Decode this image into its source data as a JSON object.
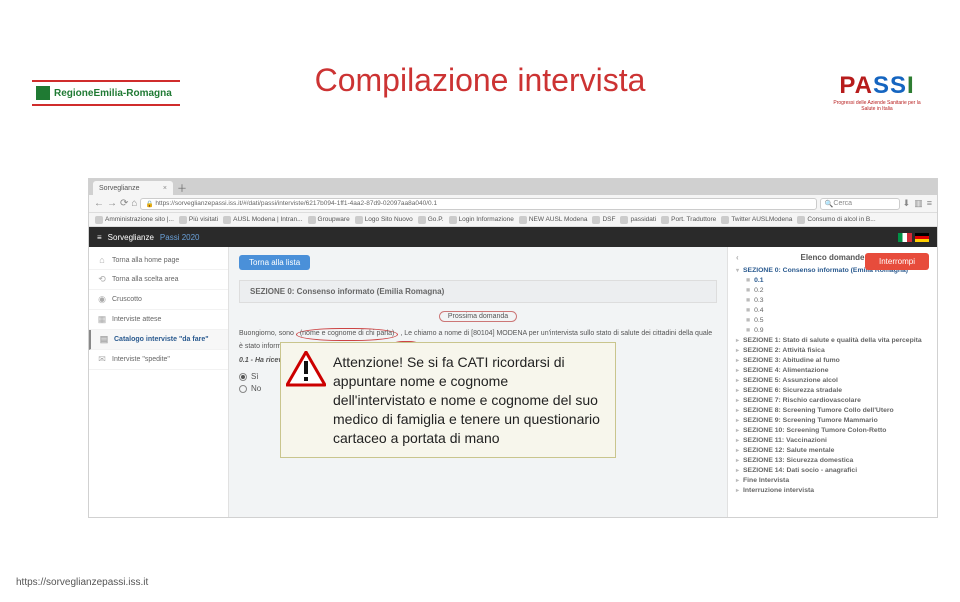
{
  "logo_left": "RegioneEmilia-Romagna",
  "logo_right": "PASSI",
  "logo_right_sub": "Progressi delle Aziende Sanitarie per la Salute in Italia",
  "title": "Compilazione intervista",
  "browser": {
    "tab": "Sorveglianze",
    "url": "https://sorveglianzepassi.iss.it/#/dati/passi/interviste/6217b094-1ff1-4aa2-87d9-02097aa8a040/0.1",
    "search": "Cerca",
    "bookmarks": [
      "Amministrazione sito |...",
      "Più visitati",
      "AUSL Modena | Intran...",
      "Groupware",
      "Logo Sito Nuovo",
      "Go.P.",
      "Login Informazione",
      "NEW AUSL Modena",
      "DSF",
      "passidati",
      "Port. Traduttore",
      "Twitter AUSLModena",
      "Consumo di alcol in B..."
    ]
  },
  "app_header": {
    "breadcrumb": "Sorveglianze",
    "project": "Passi 2020"
  },
  "sidebar": {
    "items": [
      "Torna alla home page",
      "Torna alla scelta area",
      "Cruscotto",
      "Interviste attese",
      "Catalogo interviste \"da fare\"",
      "Interviste \"spedite\""
    ],
    "active_index": 4
  },
  "interrupt_label": "Interrompi",
  "center": {
    "back_button": "Torna alla lista",
    "section_title": "SEZIONE 0: Consenso informato (Emilia Romagna)",
    "next_q": "Prossima domanda",
    "greeting_pre": "Buongiorno, sono ",
    "circle1": "(nome e cognome di chi parla)",
    "greeting_mid": ", Le chiamo a nome di [80104] MODENA per un'intervista sullo stato di salute dei cittadini della quale è stato informato anche il suo medico di famiglia ",
    "circle2": "(Dr. ...)",
    "q_num": "0.1 - Ha ricevuto per posta la lettera della ASL che Le preannuncia un'intervista telefonica?",
    "opt_yes": "Sì",
    "opt_no": "No"
  },
  "right": {
    "title": "Elenco domande",
    "sec0": "SEZIONE 0: Consenso informato (Emilia Romagna)",
    "subitems": [
      "0.1",
      "0.2",
      "0.3",
      "0.4",
      "0.5",
      "0.9"
    ],
    "sections": [
      "SEZIONE 1: Stato di salute e qualità della vita percepita",
      "SEZIONE 2: Attività fisica",
      "SEZIONE 3: Abitudine al fumo",
      "SEZIONE 4: Alimentazione",
      "SEZIONE 5: Assunzione alcol",
      "SEZIONE 6: Sicurezza stradale",
      "SEZIONE 7: Rischio cardiovascolare",
      "SEZIONE 8: Screening Tumore Collo dell'Utero",
      "SEZIONE 9: Screening Tumore Mammario",
      "SEZIONE 10: Screening Tumore Colon-Retto",
      "SEZIONE 11: Vaccinazioni",
      "SEZIONE 12: Salute mentale",
      "SEZIONE 13: Sicurezza domestica",
      "SEZIONE 14: Dati socio - anagrafici",
      "Fine Intervista",
      "Interruzione intervista"
    ]
  },
  "callout_text": "Attenzione! Se si fa CATI ricordarsi di appuntare nome e cognome dell'intervistato e nome e cognome del suo medico di famiglia e tenere un questionario cartaceo a portata di mano",
  "footer_url": "https://sorveglianzepassi.iss.it"
}
